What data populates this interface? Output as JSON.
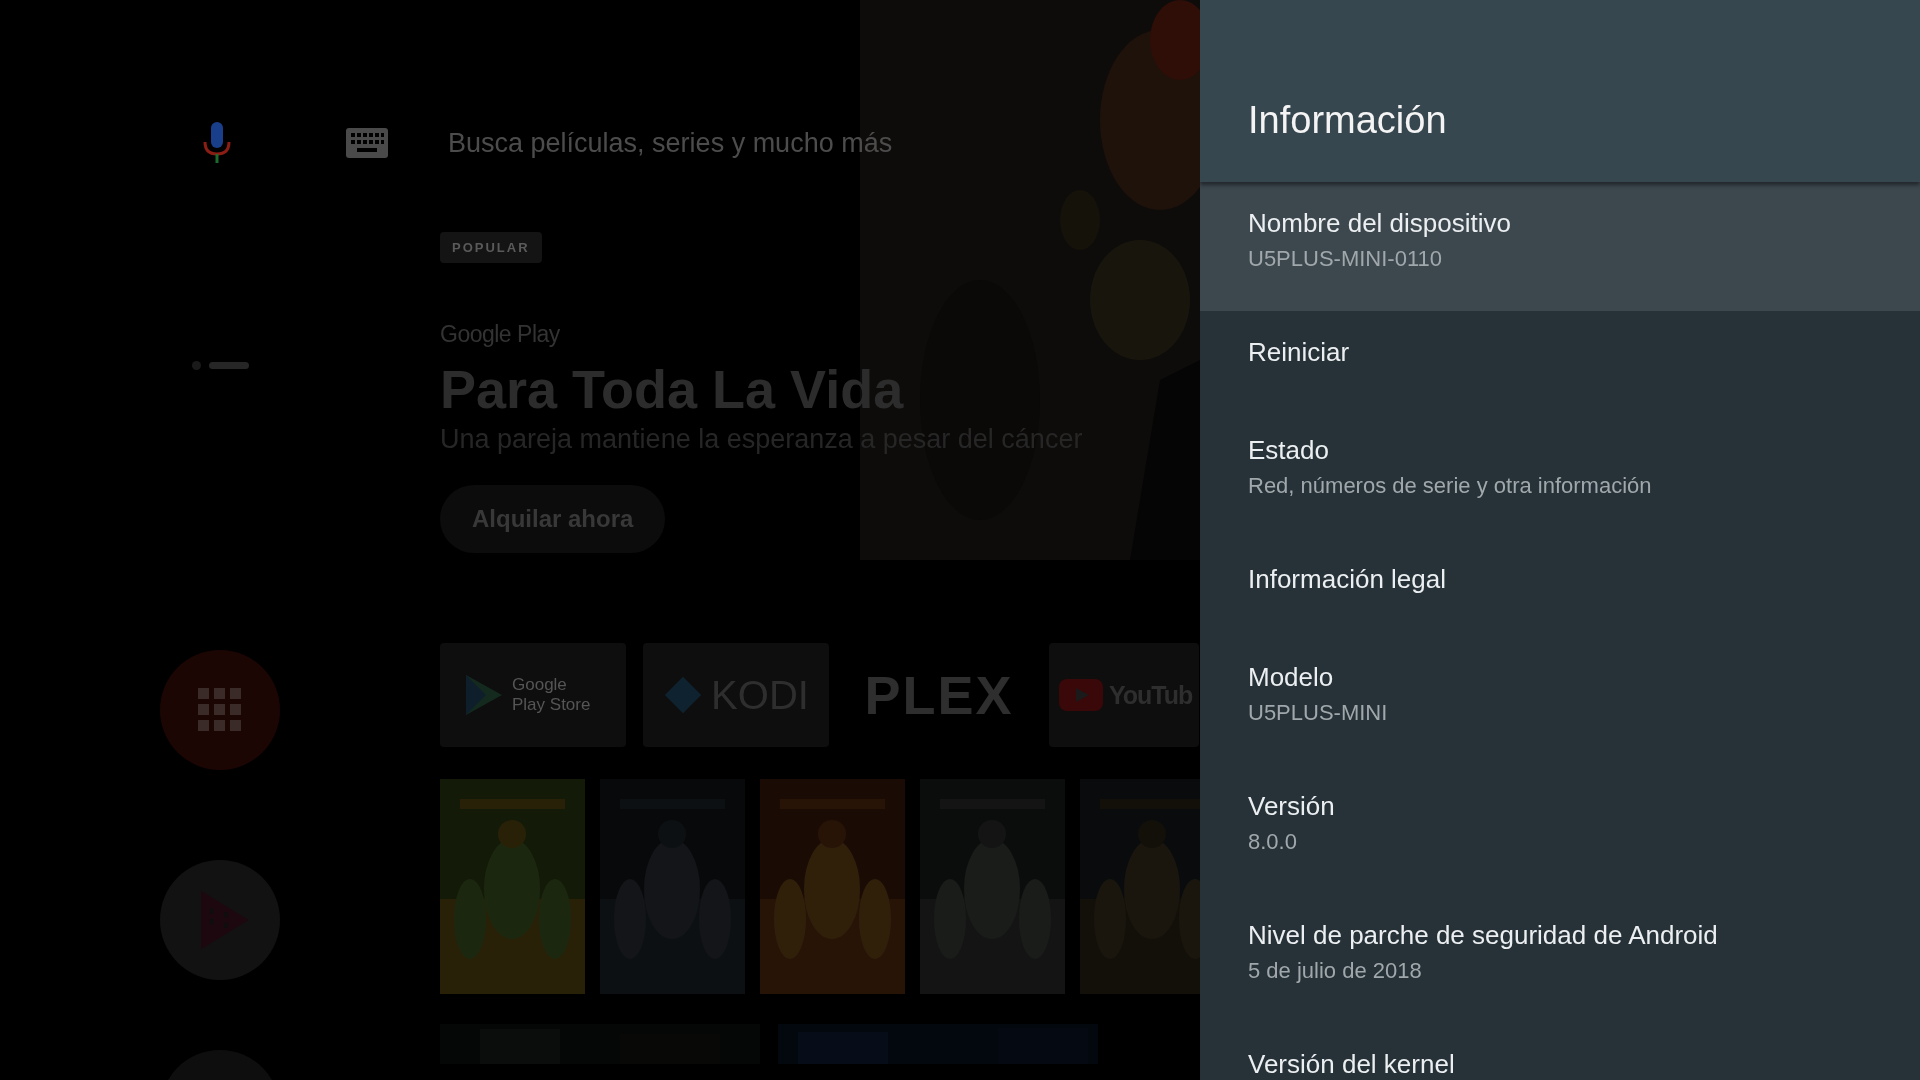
{
  "home": {
    "search": {
      "placeholder": "Busca películas, series y mucho más"
    },
    "page_dots": [
      {
        "selected": false
      },
      {
        "selected": true
      }
    ],
    "featured": {
      "badge": "POPULAR",
      "provider": "Google Play",
      "title": "Para Toda La Vida",
      "subtitle": "Una pareja mantiene la esperanza a pesar del cáncer",
      "action": "Alquilar ahora"
    },
    "apps": [
      {
        "kind": "play",
        "label": "Google Play Store"
      },
      {
        "kind": "kodi",
        "label": "KODI"
      },
      {
        "kind": "plex",
        "label": "PLEX"
      },
      {
        "kind": "youtube",
        "label": "YouTub"
      }
    ]
  },
  "panel": {
    "title": "Información",
    "items": [
      {
        "title": "Nombre del dispositivo",
        "summary": "U5PLUS-MINI-0110",
        "selected": true
      },
      {
        "title": "Reiniciar",
        "selected": false
      },
      {
        "title": "Estado",
        "summary": "Red, números de serie y otra información",
        "selected": false
      },
      {
        "title": "Información legal",
        "selected": false
      },
      {
        "title": "Modelo",
        "summary": "U5PLUS-MINI",
        "selected": false
      },
      {
        "title": "Versión",
        "summary": "8.0.0",
        "selected": false
      },
      {
        "title": "Nivel de parche de seguridad de Android",
        "summary": "5 de julio de 2018",
        "selected": false
      },
      {
        "title": "Versión del kernel",
        "selected": false
      }
    ]
  }
}
